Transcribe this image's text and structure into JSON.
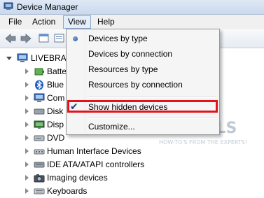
{
  "window": {
    "title": "Device Manager"
  },
  "menubar": {
    "items": [
      {
        "label": "File"
      },
      {
        "label": "Action"
      },
      {
        "label": "View"
      },
      {
        "label": "Help"
      }
    ]
  },
  "tree": {
    "root": "LIVEBRA",
    "items": [
      {
        "label": "Batte",
        "icon": "battery-icon"
      },
      {
        "label": "Blue",
        "icon": "bluetooth-icon"
      },
      {
        "label": "Com",
        "icon": "computer-icon"
      },
      {
        "label": "Disk",
        "icon": "disk-drive-icon"
      },
      {
        "label": "Disp",
        "icon": "display-adapter-icon"
      },
      {
        "label": "DVD",
        "icon": "dvd-drive-icon"
      },
      {
        "label": "Human Interface Devices",
        "icon": "hid-icon"
      },
      {
        "label": "IDE ATA/ATAPI controllers",
        "icon": "ide-controller-icon"
      },
      {
        "label": "Imaging devices",
        "icon": "camera-icon"
      },
      {
        "label": "Keyboards",
        "icon": "keyboard-icon"
      }
    ]
  },
  "view_menu": {
    "items": [
      {
        "label": "Devices by type",
        "marker": "radio"
      },
      {
        "label": "Devices by connection",
        "marker": ""
      },
      {
        "label": "Resources by type",
        "marker": ""
      },
      {
        "label": "Resources by connection",
        "marker": ""
      },
      {
        "label": "Show hidden devices",
        "marker": "check"
      },
      {
        "label": "Customize...",
        "marker": ""
      }
    ],
    "highlight_color": "#e3121b"
  },
  "watermark": {
    "brand": "APPUALS",
    "tagline": "HOW-TO'S FROM THE EXPERTS!"
  }
}
